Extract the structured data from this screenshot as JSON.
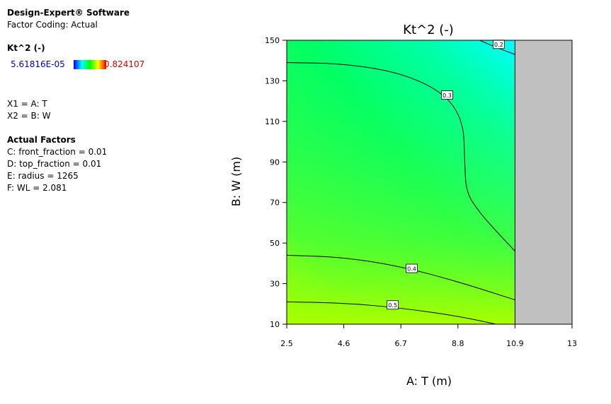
{
  "software": "Design-Expert® Software",
  "coding": "Factor Coding: Actual",
  "response": {
    "name": "Kt^2 (-)",
    "min_label": "5.61816E-05",
    "max_label": "0.824107",
    "min_color": "#0000cc",
    "max_color": "#e00000"
  },
  "axes_assign": [
    "X1 = A: T",
    "X2 = B: W"
  ],
  "actual_factors": {
    "title": "Actual Factors",
    "items": [
      "C: front_fraction = 0.01",
      "D: top_fraction = 0.01",
      "E: radius = 1265",
      "F: WL = 2.081"
    ]
  },
  "chart_data": {
    "type": "contour",
    "title": "Kt^2 (-)",
    "xlabel": "A: T (m)",
    "ylabel": "B: W (m)",
    "xlim": [
      2.5,
      13
    ],
    "ylim": [
      10,
      150
    ],
    "x_ticks": [
      "2.5",
      "4.6",
      "6.7",
      "8.8",
      "10.9",
      "13"
    ],
    "y_ticks": [
      "10",
      "30",
      "50",
      "70",
      "90",
      "110",
      "130",
      "150"
    ],
    "design_space_xmax": 10.9,
    "excluded_region_color": "#c0c0c0",
    "contours": [
      {
        "level": "0.2",
        "points": [
          [
            9.6,
            150
          ],
          [
            10.2,
            146.5
          ],
          [
            10.9,
            143
          ]
        ],
        "label_at": [
          10.3,
          148
        ]
      },
      {
        "level": "0.3",
        "points": [
          [
            2.5,
            139
          ],
          [
            4.6,
            138.5
          ],
          [
            6.7,
            134
          ],
          [
            8.3,
            124
          ],
          [
            9.0,
            110
          ],
          [
            9.05,
            90
          ],
          [
            9.1,
            75
          ],
          [
            9.6,
            65
          ],
          [
            10.2,
            56
          ],
          [
            10.9,
            46
          ]
        ],
        "label_at": [
          8.4,
          123
        ]
      },
      {
        "level": "0.4",
        "points": [
          [
            2.5,
            44
          ],
          [
            4.6,
            43
          ],
          [
            6.7,
            38.5
          ],
          [
            8.8,
            31
          ],
          [
            10.9,
            22
          ]
        ],
        "label_at": [
          7.1,
          37.5
        ]
      },
      {
        "level": "0.5",
        "points": [
          [
            2.5,
            21
          ],
          [
            4.6,
            20.5
          ],
          [
            6.7,
            18
          ],
          [
            8.8,
            14
          ],
          [
            10.2,
            10
          ]
        ],
        "label_at": [
          6.4,
          19.5
        ]
      }
    ]
  }
}
